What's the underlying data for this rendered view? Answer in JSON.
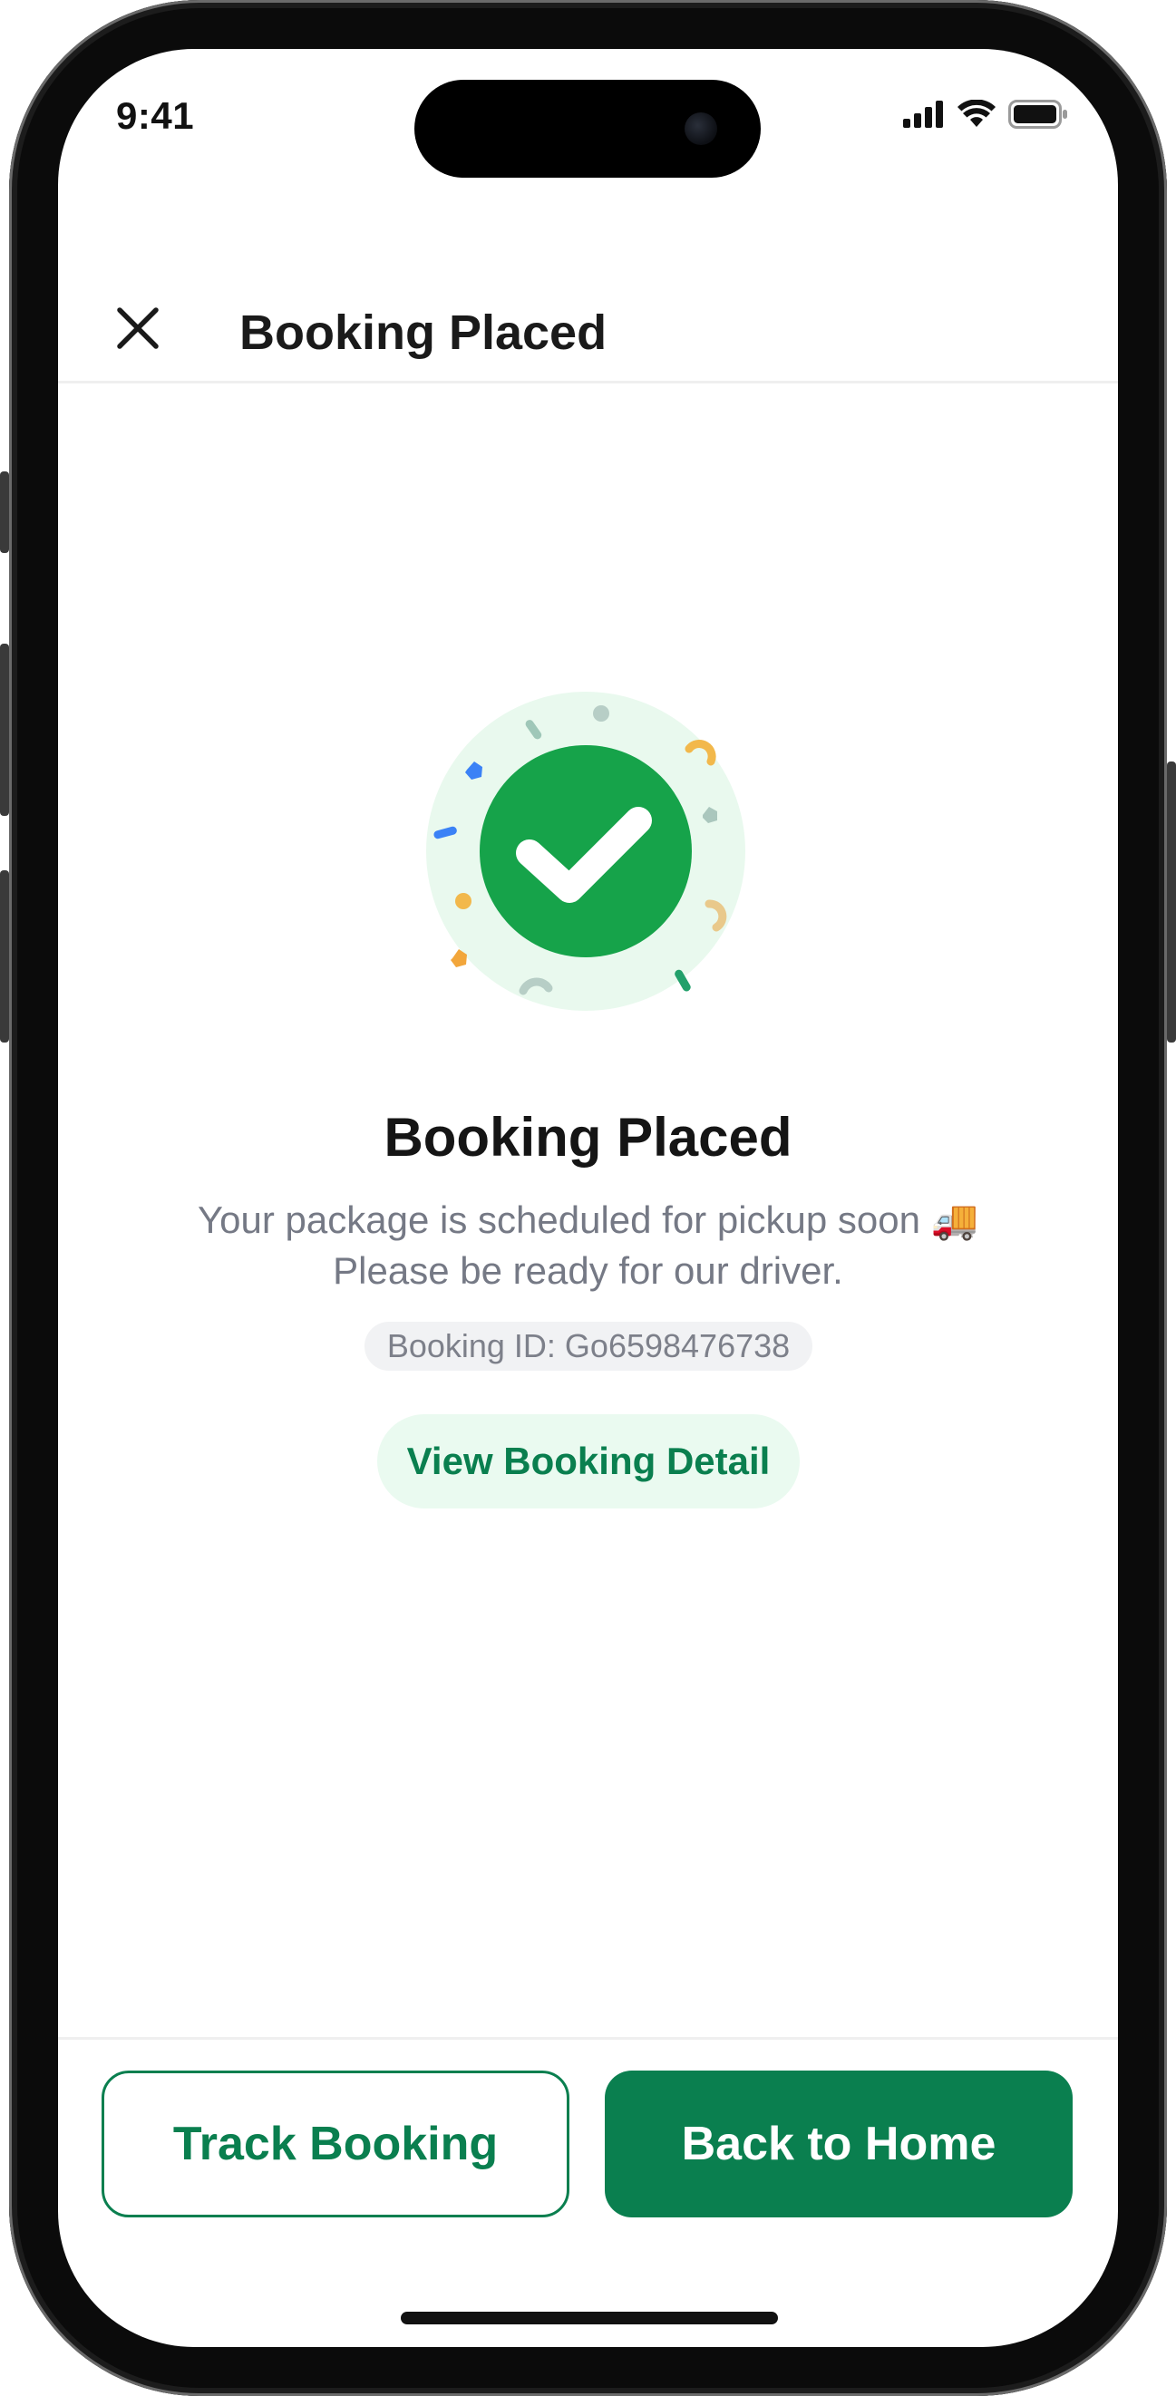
{
  "status_bar": {
    "time": "9:41"
  },
  "header": {
    "title": "Booking Placed"
  },
  "main": {
    "title": "Booking Placed",
    "subtitle_line1": "Your package is scheduled for pickup soon 🚚",
    "subtitle_line2": "Please be ready for our driver.",
    "booking_id": "Booking ID: Go6598476738",
    "view_detail_label": "View Booking Detail"
  },
  "footer": {
    "track_label": "Track Booking",
    "home_label": "Back to Home"
  },
  "colors": {
    "brand_green": "#0a7f4f",
    "check_green": "#16a34a",
    "halo_green": "#e9f9ee",
    "muted_text": "#757985"
  }
}
